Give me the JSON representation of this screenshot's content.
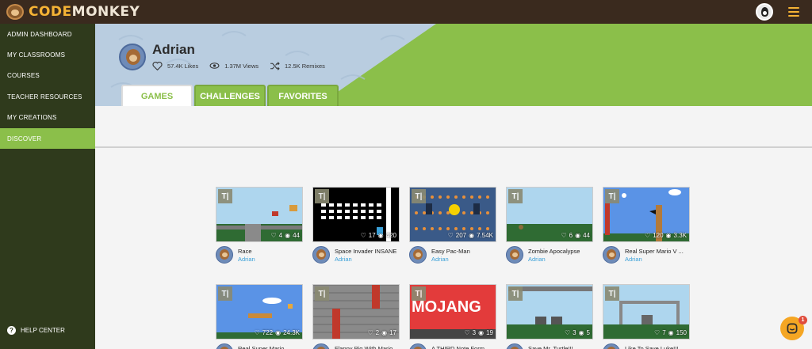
{
  "brand": {
    "part1": "CODE",
    "part2": "MONKEY"
  },
  "sidebar": {
    "items": [
      {
        "label": "ADMIN DASHBOARD"
      },
      {
        "label": "MY CLASSROOMS"
      },
      {
        "label": "COURSES"
      },
      {
        "label": "TEACHER RESOURCES"
      },
      {
        "label": "MY CREATIONS"
      },
      {
        "label": "DISCOVER",
        "active": true
      }
    ],
    "help_label": "HELP CENTER"
  },
  "profile": {
    "name": "Adrian",
    "likes": "57.4K Likes",
    "views": "1.37M Views",
    "remixes": "12.5K Remixes"
  },
  "tabs": [
    {
      "label": "GAMES",
      "active": true
    },
    {
      "label": "CHALLENGES"
    },
    {
      "label": "FAVORITES"
    }
  ],
  "games": [
    {
      "title": "Race",
      "author": "Adrian",
      "likes": "4",
      "views": "44",
      "thumb": "race"
    },
    {
      "title": "Space Invader INSANE",
      "author": "Adrian",
      "likes": "17",
      "views": "420",
      "thumb": "space"
    },
    {
      "title": "Easy Pac-Man",
      "author": "Adrian",
      "likes": "207",
      "views": "7.54K",
      "thumb": "pacman"
    },
    {
      "title": "Zombie Apocalypse",
      "author": "Adrian",
      "likes": "6",
      "views": "44",
      "thumb": "zombie"
    },
    {
      "title": "Real Super Mario V ...",
      "author": "Adrian",
      "likes": "120",
      "views": "3.3K",
      "thumb": "mario"
    },
    {
      "title": "Real Super Mario ...",
      "author": "",
      "likes": "722",
      "views": "24.3K",
      "thumb": "mario2"
    },
    {
      "title": "Flappy Pig With Mario ...",
      "author": "",
      "likes": "2",
      "views": "17",
      "thumb": "flappy"
    },
    {
      "title": "A THIRD Note Form ...",
      "author": "",
      "likes": "3",
      "views": "19",
      "thumb": "mojang"
    },
    {
      "title": "Save Mr. Turtle!!! ...",
      "author": "",
      "likes": "3",
      "views": "5",
      "thumb": "turtle"
    },
    {
      "title": "Like To Save Luke!!! ...",
      "author": "",
      "likes": "7",
      "views": "150",
      "thumb": "luke"
    }
  ],
  "thumb_label": "T|",
  "chat": {
    "badge": "1"
  }
}
